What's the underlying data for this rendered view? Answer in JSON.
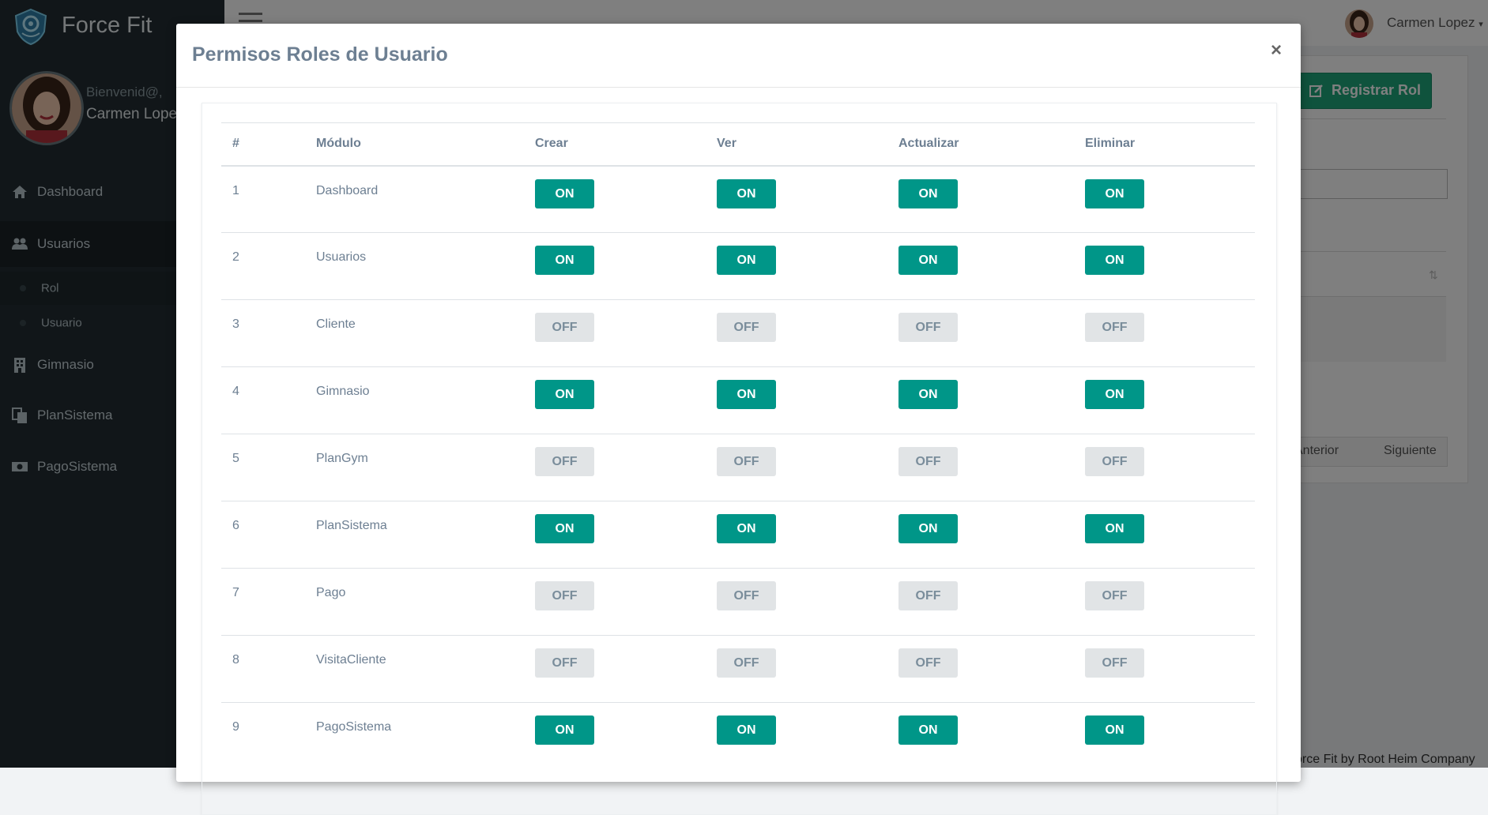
{
  "app": {
    "name": "Force Fit",
    "footer": "orce Fit by Root Heim Company"
  },
  "profile": {
    "greeting": "Bienvenid@,",
    "name": "Carmen Lopez"
  },
  "topbar": {
    "user_name": "Carmen Lopez"
  },
  "sidebar": {
    "items": [
      {
        "label": "Dashboard",
        "icon": "home-icon"
      },
      {
        "label": "Usuarios",
        "icon": "users-icon"
      },
      {
        "label": "Gimnasio",
        "icon": "building-icon"
      },
      {
        "label": "PlanSistema",
        "icon": "files-icon"
      },
      {
        "label": "PagoSistema",
        "icon": "money-icon"
      }
    ],
    "sub_items": [
      {
        "label": "Rol"
      },
      {
        "label": "Usuario"
      }
    ]
  },
  "background": {
    "register_button": "Registrar Rol",
    "pager_prev": "Anterior",
    "pager_next": "Siguiente"
  },
  "modal": {
    "title": "Permisos Roles de Usuario",
    "close_symbol": "×",
    "columns": [
      "#",
      "Módulo",
      "Crear",
      "Ver",
      "Actualizar",
      "Eliminar"
    ],
    "rows": [
      {
        "num": "1",
        "module": "Dashboard",
        "crear": "ON",
        "ver": "ON",
        "actualizar": "ON",
        "eliminar": "ON"
      },
      {
        "num": "2",
        "module": "Usuarios",
        "crear": "ON",
        "ver": "ON",
        "actualizar": "ON",
        "eliminar": "ON"
      },
      {
        "num": "3",
        "module": "Cliente",
        "crear": "OFF",
        "ver": "OFF",
        "actualizar": "OFF",
        "eliminar": "OFF"
      },
      {
        "num": "4",
        "module": "Gimnasio",
        "crear": "ON",
        "ver": "ON",
        "actualizar": "ON",
        "eliminar": "ON"
      },
      {
        "num": "5",
        "module": "PlanGym",
        "crear": "OFF",
        "ver": "OFF",
        "actualizar": "OFF",
        "eliminar": "OFF"
      },
      {
        "num": "6",
        "module": "PlanSistema",
        "crear": "ON",
        "ver": "ON",
        "actualizar": "ON",
        "eliminar": "ON"
      },
      {
        "num": "7",
        "module": "Pago",
        "crear": "OFF",
        "ver": "OFF",
        "actualizar": "OFF",
        "eliminar": "OFF"
      },
      {
        "num": "8",
        "module": "VisitaCliente",
        "crear": "OFF",
        "ver": "OFF",
        "actualizar": "OFF",
        "eliminar": "OFF"
      },
      {
        "num": "9",
        "module": "PagoSistema",
        "crear": "ON",
        "ver": "ON",
        "actualizar": "ON",
        "eliminar": "ON"
      }
    ]
  },
  "colors": {
    "toggle_on": "#009688",
    "toggle_off": "#e1e4e6",
    "sidebar_bg": "#222d32",
    "register_button": "#1fa67a"
  }
}
